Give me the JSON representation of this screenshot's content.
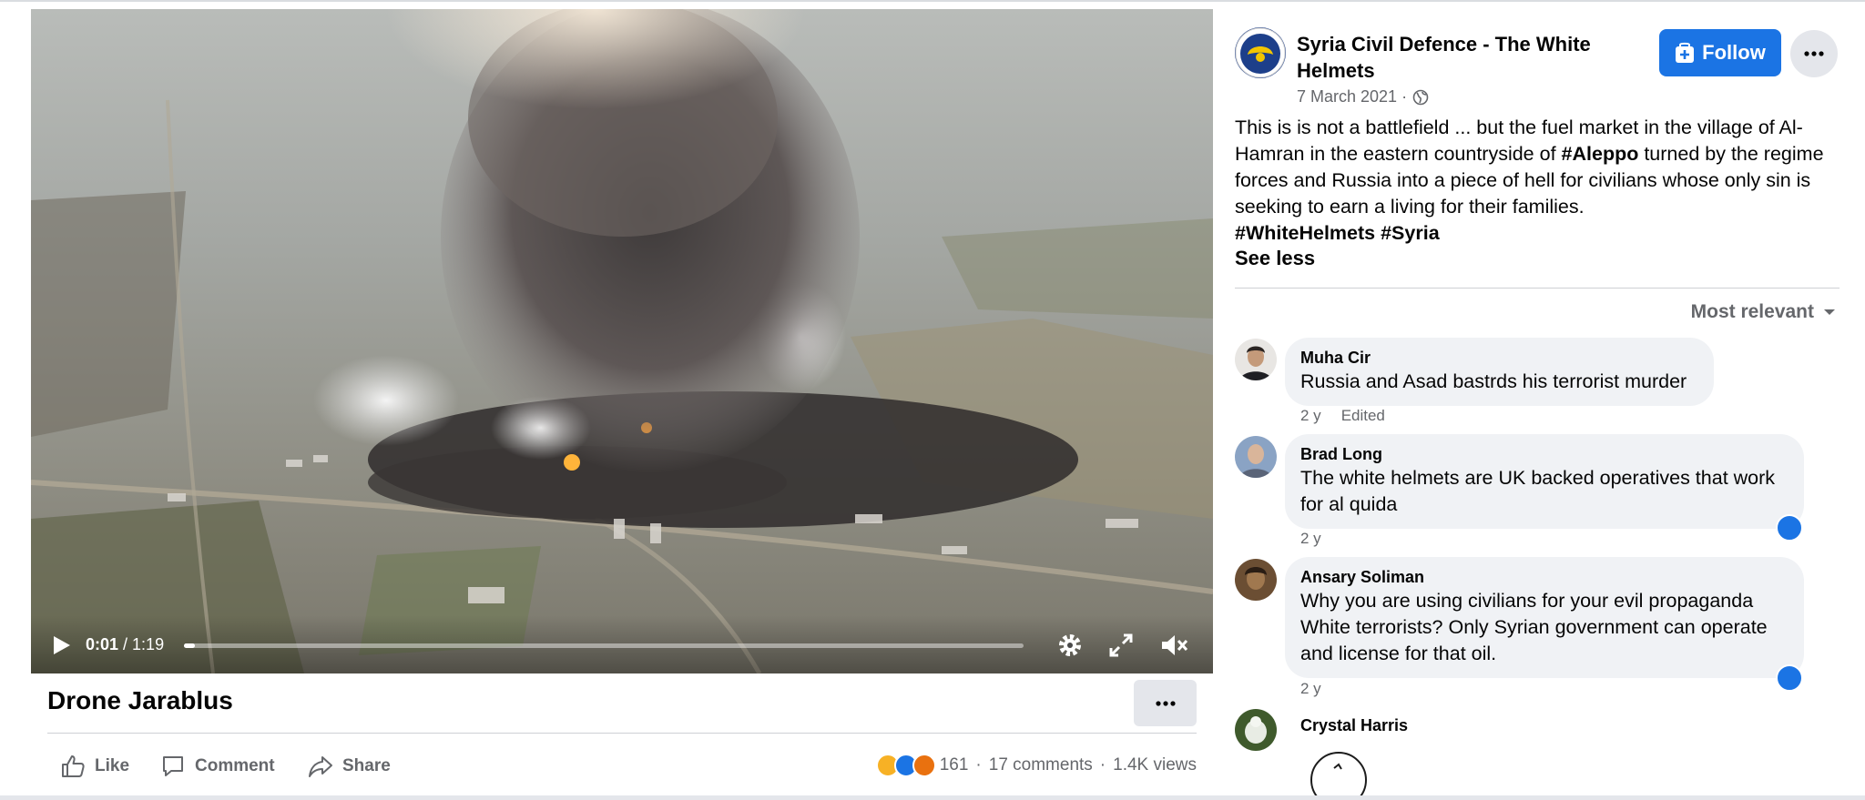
{
  "video": {
    "current_time": "0:01",
    "duration": "/ 1:19",
    "progress_fraction": 0.013
  },
  "post": {
    "title": "Drone Jarablus",
    "actions": {
      "like": "Like",
      "comment": "Comment",
      "share": "Share"
    },
    "reactions": [
      "sad",
      "like",
      "angry"
    ],
    "reaction_count": "161",
    "comments_count": "17 comments",
    "views": "1.4K views"
  },
  "page": {
    "name": "Syria Civil Defence - The White Helmets",
    "date": "7 March 2021 ·",
    "privacy_icon": "globe-icon",
    "follow_label": "Follow"
  },
  "description": {
    "part1": "This is is not a battlefield ... but the fuel market in the village of Al-Hamran in the eastern countryside of ",
    "hashtag1": "#Aleppo",
    "part2": " turned by the regime forces and Russia into a piece of hell for civilians whose only sin is seeking to earn a living for their families.",
    "hashtags": "#WhiteHelmets #Syria",
    "see_less": "See less"
  },
  "comments_sort": "Most relevant",
  "comments": [
    {
      "author": "Muha Cir",
      "text": "Russia and Asad bastrds his terrorist murder",
      "time": "2 y",
      "edited": "Edited"
    },
    {
      "author": "Brad Long",
      "text": "The white helmets are UK backed operatives that work for al quida",
      "time": "2 y"
    },
    {
      "author": "Ansary Soliman",
      "text": "Why you are using civilians for your evil propaganda White terrorists? Only Syrian government can operate and license for that oil.",
      "time": "2 y"
    },
    {
      "author": "Crystal Harris"
    }
  ],
  "colors": {
    "accent": "#1b74e4",
    "secondary_text": "#65676b",
    "bubble": "#f0f2f5",
    "button_gray": "#e4e6eb"
  }
}
